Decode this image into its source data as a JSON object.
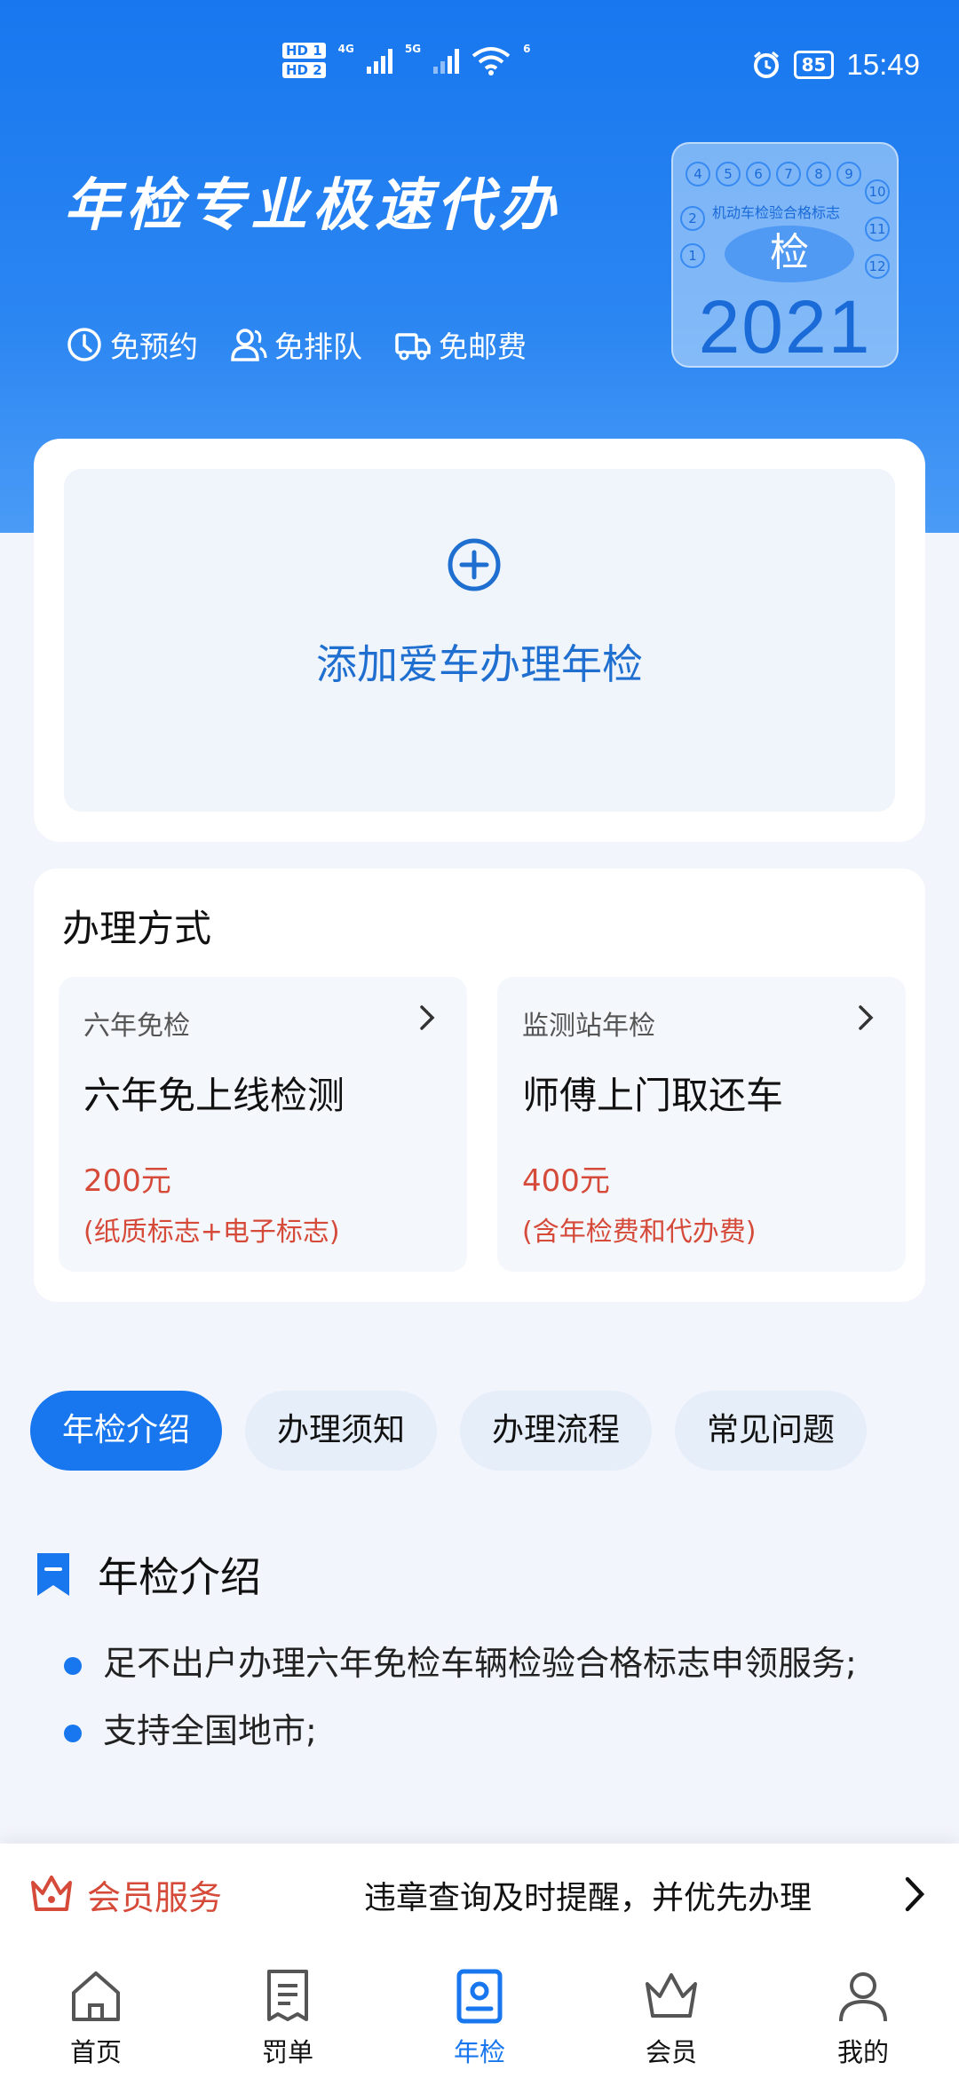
{
  "status_bar": {
    "hd1": "HD 1",
    "hd2": "HD 2",
    "net1": "4G",
    "net2": "5G",
    "wifi": "6",
    "battery": "85",
    "time": "15:49"
  },
  "hero": {
    "title": "年检专业极速代办",
    "perks": [
      {
        "icon": "clock-icon",
        "label": "免预约"
      },
      {
        "icon": "people-icon",
        "label": "免排队"
      },
      {
        "icon": "truck-icon",
        "label": "免邮费"
      }
    ],
    "sticker": {
      "numbers_top": [
        "4",
        "5",
        "6",
        "7",
        "8",
        "9"
      ],
      "numbers_left": [
        "2",
        "1"
      ],
      "numbers_right": [
        "10",
        "11",
        "12"
      ],
      "note": "机动车检验合格标志",
      "char": "检",
      "year": "2021"
    }
  },
  "add_car": {
    "label": "添加爱车办理年检"
  },
  "methods": {
    "title": "办理方式",
    "options": [
      {
        "category": "六年免检",
        "name": "六年免上线检测",
        "price": "200元",
        "note": "(纸质标志+电子标志)"
      },
      {
        "category": "监测站年检",
        "name": "师傅上门取还车",
        "price": "400元",
        "note": "(含年检费和代办费)"
      }
    ]
  },
  "tabs": [
    {
      "label": "年检介绍",
      "active": true
    },
    {
      "label": "办理须知",
      "active": false
    },
    {
      "label": "办理流程",
      "active": false
    },
    {
      "label": "常见问题",
      "active": false
    }
  ],
  "intro": {
    "title": "年检介绍",
    "bullets": [
      "足不出户办理六年免检车辆检验合格标志申领服务;",
      "支持全国地市;"
    ]
  },
  "member_bar": {
    "label": "会员服务",
    "text": "违章查询及时提醒，并优先办理"
  },
  "bottom_nav": [
    {
      "label": "首页",
      "icon": "home-icon",
      "active": false
    },
    {
      "label": "罚单",
      "icon": "ticket-icon",
      "active": false
    },
    {
      "label": "年检",
      "icon": "inspection-icon",
      "active": true
    },
    {
      "label": "会员",
      "icon": "crown-icon",
      "active": false
    },
    {
      "label": "我的",
      "icon": "profile-icon",
      "active": false
    }
  ],
  "colors": {
    "primary": "#1877ef",
    "price_red": "#d64a3a"
  }
}
